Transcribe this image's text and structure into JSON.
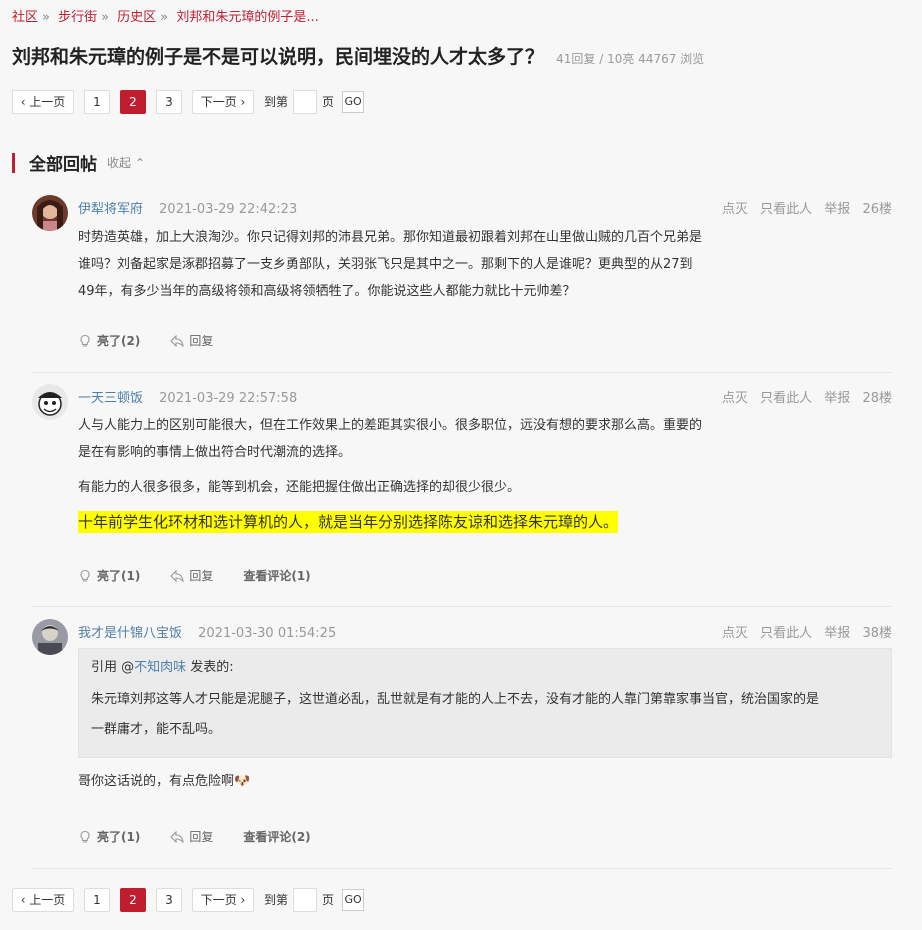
{
  "breadcrumb": [
    "社区",
    "步行街",
    "历史区",
    "刘邦和朱元璋的例子是..."
  ],
  "thread": {
    "title": "刘邦和朱元璋的例子是不是可以说明，民间埋没的人才太多了？",
    "stats": "41回复 / 10亮 44767 浏览"
  },
  "pager": {
    "prev": "‹ 上一页",
    "pages": [
      "1",
      "2",
      "3"
    ],
    "current": "2",
    "next": "下一页 ›",
    "goto_label": "到第",
    "page_suffix": "页",
    "go": "GO"
  },
  "section": {
    "title": "全部回帖",
    "collapse": "收起 ⌃"
  },
  "tools": {
    "dim": "点灭",
    "only": "只看此人",
    "report": "举报"
  },
  "posts": [
    {
      "user": "伊犁将军府",
      "time": "2021-03-29 22:42:23",
      "floor": "26楼",
      "lines": [
        "时势造英雄，加上大浪淘沙。你只记得刘邦的沛县兄弟。那你知道最初跟着刘邦在山里做山贼的几百个兄弟是",
        "谁吗？刘备起家是涿郡招募了一支乡勇部队，关羽张飞只是其中之一。那剩下的人是谁呢？更典型的从27到",
        "49年，有多少当年的高级将领和高级将领牺牲了。你能说这些人都能力就比十元帅差？"
      ],
      "like": "亮了(2)",
      "reply": "回复"
    },
    {
      "user": "一天三顿饭",
      "time": "2021-03-29 22:57:58",
      "floor": "28楼",
      "lines": [
        "人与人能力上的区别可能很大，但在工作效果上的差距其实很小。很多职位，远没有想的要求那么高。重要的",
        "是在有影响的事情上做出符合时代潮流的选择。"
      ],
      "line3": "有能力的人很多很多，能等到机会，还能把握住做出正确选择的却很少很少。",
      "highlight": "十年前学生化环材和选计算机的人，就是当年分别选择陈友谅和选择朱元璋的人。",
      "like": "亮了(1)",
      "reply": "回复",
      "comments": "查看评论(1)"
    },
    {
      "user": "我才是什锦八宝饭",
      "time": "2021-03-30 01:54:25",
      "floor": "38楼",
      "quote_prefix": "引用 @",
      "quote_user": "不知肉味",
      "quote_suffix": " 发表的:",
      "quote_lines": [
        "朱元璋刘邦这等人才只能是泥腿子，这世道必乱，乱世就是有才能的人上不去，没有才能的人靠门第靠家事当官，统治国家的是",
        "一群庸才，能不乱吗。"
      ],
      "text": "哥你这话说的，有点危险啊🐶",
      "like": "亮了(1)",
      "reply": "回复",
      "comments": "查看评论(2)"
    }
  ]
}
